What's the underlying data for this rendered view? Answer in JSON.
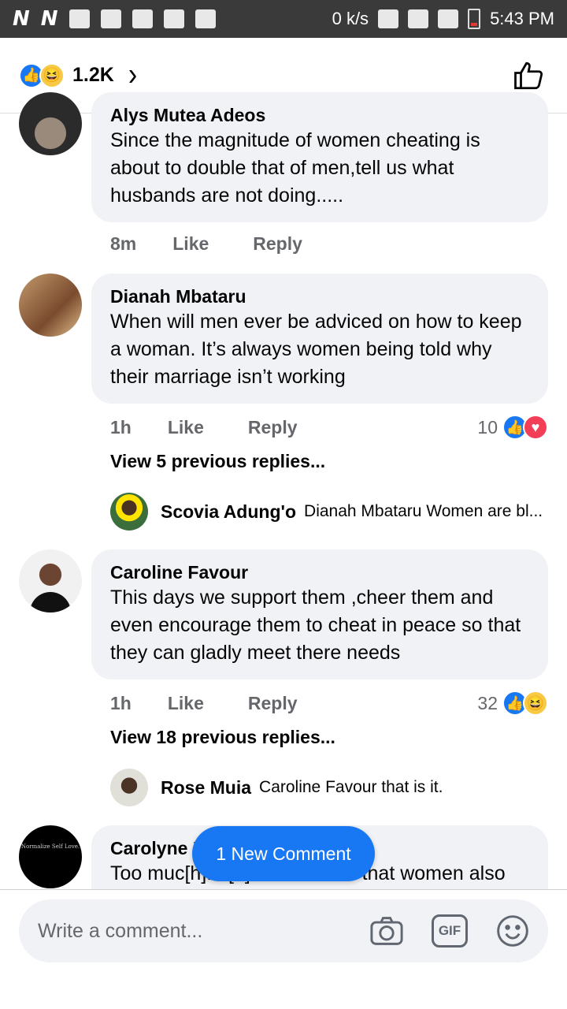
{
  "status_bar": {
    "net_speed": "0 k/s",
    "time": "5:43 PM",
    "n1": "N",
    "n2": "N"
  },
  "header": {
    "reaction_count": "1.2K"
  },
  "comments": [
    {
      "author": "Alys Mutea Adeos",
      "text": "Since the magnitude of women cheating is about to double that of men,tell us what husbands are not doing.....",
      "time": "8m",
      "like": "Like",
      "reply": "Reply"
    },
    {
      "author": "Dianah Mbataru",
      "text": "When will men ever be adviced on how to keep a woman. It’s always women being told why their marriage isn’t working",
      "time": "1h",
      "like": "Like",
      "reply": "Reply",
      "reactions": "10",
      "view_more": "View 5 previous replies...",
      "reply_preview": {
        "name": "Scovia Adung'o",
        "text": "Dianah Mbataru Women are bl..."
      }
    },
    {
      "author": "Caroline Favour",
      "text": "This days we support them ,cheer them and even encourage them to cheat in peace so that they can gladly meet there needs",
      "time": "1h",
      "like": "Like",
      "reply": "Reply",
      "reactions": "32",
      "view_more": "View 18 previous replies...",
      "reply_preview": {
        "name": "Rose Muia",
        "text": "Caroline Favour that is it."
      }
    },
    {
      "author": "Carolyne D",
      "text": "Too muc[h]... [d]id it occur to that women also have needs? So, do we",
      "avatar_text": "Normalize Self Love."
    }
  ],
  "new_comment_pill": "1 New Comment",
  "composer": {
    "placeholder": "Write a comment..."
  },
  "icons": [
    "thumbs-up-icon",
    "haha-icon",
    "love-icon",
    "chevron-right-icon",
    "camera-icon",
    "gif-icon",
    "smiley-icon"
  ],
  "colors": {
    "like_blue": "#1877f2",
    "bubble": "#f0f2f5",
    "meta_gray": "#65676b"
  }
}
